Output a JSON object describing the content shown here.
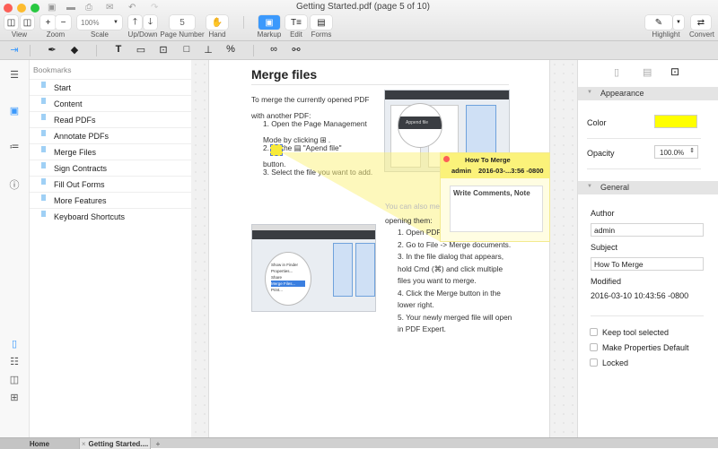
{
  "window": {
    "title": "Getting Started.pdf (page 5 of 10)"
  },
  "toolbar": {
    "view_label": "View",
    "zoom_label": "Zoom",
    "zoom_in": "+",
    "zoom_out": "−",
    "scale_label": "Scale",
    "scale_value": "100%",
    "updown_label": "Up/Down",
    "page_number_label": "Page Number",
    "page_number_value": "5",
    "hand_label": "Hand",
    "markup_label": "Markup",
    "edit_label": "Edit",
    "forms_label": "Forms",
    "highlight_label": "Highlight",
    "convert_label": "Convert",
    "accent": "#3b99fc"
  },
  "sidebar": {
    "title": "Bookmarks",
    "items": [
      {
        "label": "Start"
      },
      {
        "label": "Content"
      },
      {
        "label": "Read PDFs"
      },
      {
        "label": "Annotate PDFs"
      },
      {
        "label": "Merge Files"
      },
      {
        "label": "Sign Contracts"
      },
      {
        "label": "Fill Out Forms"
      },
      {
        "label": "More Features"
      },
      {
        "label": "Keyboard Shortcuts"
      }
    ]
  },
  "page": {
    "title": "Merge files",
    "intro": [
      "To merge the currently opened PDF",
      "with another PDF:"
    ],
    "steps1": [
      "1. Open the Page Management",
      "Mode by clicking ⊞ .",
      "2.         on the ▤ \"Apend file\"",
      "button.",
      "3. Select the file you want to add."
    ],
    "also": [
      "You can also merge files without even",
      "opening them:"
    ],
    "steps2": [
      "1. Open PDF Expert for Mac.",
      "2. Go to File -> Merge documents.",
      "3. In the file dialog that appears,",
      "hold Cmd (⌘) and click multiple",
      "files you want to merge.",
      "4. Click the Merge button in the",
      "lower right.",
      "5. Your newly merged file will open",
      "in PDF Expert."
    ],
    "shot1_button": "Append file",
    "shot2_menu": [
      "Show in Finder",
      "Properties...",
      "Share",
      "Merge Files...",
      "Print..."
    ]
  },
  "note": {
    "title": "How To Merge",
    "author": "admin",
    "date": "2016-03-...3:56 -0800",
    "placeholder": "Write Comments, Note",
    "color": "#fbf27a"
  },
  "properties": {
    "appearance_label": "Appearance",
    "color_label": "Color",
    "color_value": "#ffff00",
    "opacity_label": "Opacity",
    "opacity_value": "100.0%",
    "general_label": "General",
    "author_label": "Author",
    "author_value": "admin",
    "subject_label": "Subject",
    "subject_value": "How To Merge",
    "modified_label": "Modified",
    "modified_value": "2016-03-10 10:43:56 -0800",
    "options": [
      {
        "label": "Keep tool selected",
        "checked": false
      },
      {
        "label": "Make Properties Default",
        "checked": false
      },
      {
        "label": "Locked",
        "checked": false
      }
    ]
  },
  "tabs": [
    {
      "label": "Home"
    },
    {
      "label": "Getting Started...."
    }
  ],
  "tab_close": "×",
  "tab_add": "+"
}
